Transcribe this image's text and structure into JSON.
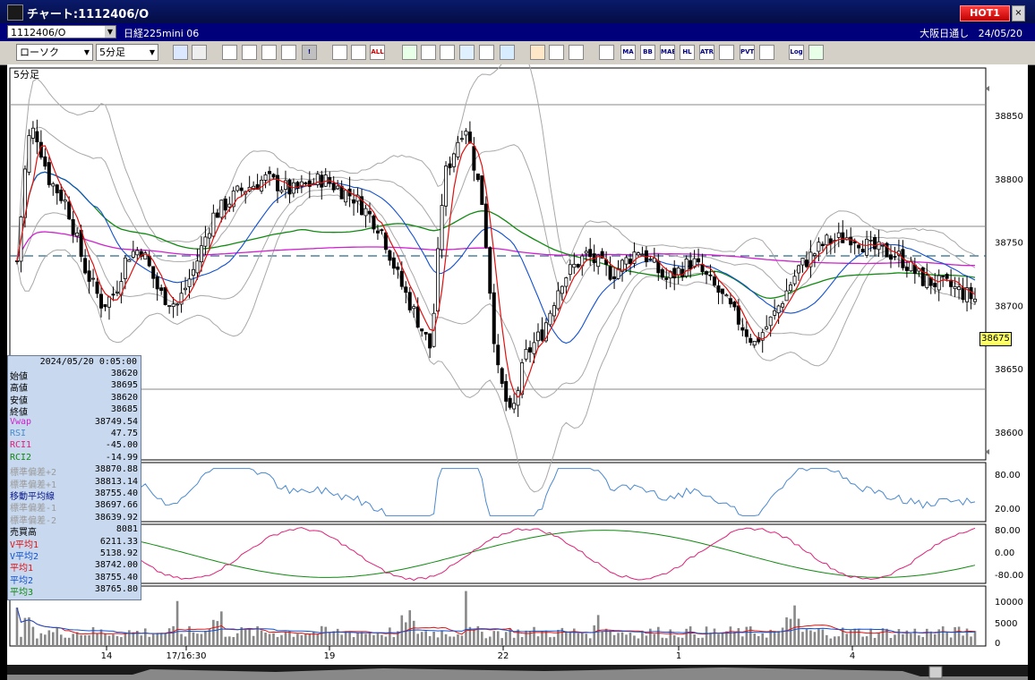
{
  "window": {
    "title": "チャート:1112406/O",
    "hot_label": "HOT1",
    "min": "_",
    "max": "□",
    "close": "×"
  },
  "infobar": {
    "code": "1112406/O",
    "name": "日経225mini 06",
    "market": "大阪日通し",
    "date": "24/05/20"
  },
  "toolbar": {
    "chart_type": "ローソク",
    "period": "5分足",
    "buttons": [
      {
        "icon": "zoom-icon",
        "text": ""
      },
      {
        "icon": "layout-icon",
        "text": ""
      },
      {
        "icon": "cut-icon",
        "text": ""
      },
      {
        "icon": "find-icon",
        "text": ""
      },
      {
        "icon": "bar-icon",
        "text": ""
      },
      {
        "icon": "sign-icon",
        "text": ""
      },
      {
        "icon": "warn-icon",
        "text": "!"
      },
      {
        "icon": "cross-icon",
        "text": ""
      },
      {
        "icon": "cross2-icon",
        "text": ""
      },
      {
        "icon": "all-icon",
        "text": "ALL"
      },
      {
        "icon": "pen-icon",
        "text": ""
      },
      {
        "icon": "line-icon",
        "text": ""
      },
      {
        "icon": "pointer-icon",
        "text": ""
      },
      {
        "icon": "arrow-icon",
        "text": ""
      },
      {
        "icon": "list-icon",
        "text": ""
      },
      {
        "icon": "trash-icon",
        "text": ""
      },
      {
        "icon": "setting-icon",
        "text": ""
      },
      {
        "icon": "wrench-icon",
        "text": ""
      },
      {
        "icon": "palette-icon",
        "text": ""
      },
      {
        "icon": "indicator-icon",
        "text": ""
      },
      {
        "icon": "ma-icon",
        "text": "MA"
      },
      {
        "icon": "bb-icon",
        "text": "BB"
      },
      {
        "icon": "mae-icon",
        "text": "MAE"
      },
      {
        "icon": "hl-icon",
        "text": "HL"
      },
      {
        "icon": "atr-icon",
        "text": "ATR"
      },
      {
        "icon": "grid-icon",
        "text": ""
      },
      {
        "icon": "pvt-icon",
        "text": "PVT"
      },
      {
        "icon": "box-icon",
        "text": ""
      },
      {
        "icon": "log-icon",
        "text": "Log"
      },
      {
        "icon": "export-icon",
        "text": ""
      }
    ]
  },
  "chart": {
    "period_label": "5分足",
    "price_axis": [
      "38850",
      "38800",
      "38750",
      "38700",
      "38650",
      "38600"
    ],
    "rsi_axis": [
      "80.00",
      "20.00"
    ],
    "rci_axis": [
      "80.00",
      "0.00",
      "-80.00"
    ],
    "vol_axis": [
      "10000",
      "5000",
      "0"
    ],
    "x_labels": [
      "14",
      "17/16:30",
      "19",
      "22",
      "1",
      "4"
    ],
    "current_price": "38675",
    "colors": {
      "up": "#ffffff",
      "down": "#000000",
      "rsi": "#4a8ad0",
      "rci1": "#e0207a",
      "rci2": "#108a10",
      "ma_red": "#e01010",
      "ma_blue": "#1050d0",
      "ma_green": "#108a10",
      "vwap": "#d020d0",
      "bands": "#a8a8a8",
      "volume": "#888888"
    }
  },
  "panel": {
    "timestamp": "2024/05/20  0:05:00",
    "rows": [
      {
        "label": "始値",
        "value": "38620",
        "color": "#000000"
      },
      {
        "label": "高値",
        "value": "38695",
        "color": "#000000"
      },
      {
        "label": "安値",
        "value": "38620",
        "color": "#000000"
      },
      {
        "label": "終値",
        "value": "38685",
        "color": "#000000"
      },
      {
        "label": "Vwap",
        "value": "38749.54",
        "color": "#d020d0"
      },
      {
        "label": "RSI",
        "value": "47.75",
        "color": "#4a8ad0"
      },
      {
        "label": "RCI1",
        "value": "-45.00",
        "color": "#e0207a"
      },
      {
        "label": "RCI2",
        "value": "-14.99",
        "color": "#108a10"
      },
      {
        "label": "標準偏差+2",
        "value": "38870.88",
        "color": "#9a9a9a"
      },
      {
        "label": "標準偏差+1",
        "value": "38813.14",
        "color": "#9a9a9a"
      },
      {
        "label": "移動平均線",
        "value": "38755.40",
        "color": "#0a1a8a"
      },
      {
        "label": "標準偏差-1",
        "value": "38697.66",
        "color": "#9a9a9a"
      },
      {
        "label": "標準偏差-2",
        "value": "38639.92",
        "color": "#9a9a9a"
      },
      {
        "label": "売買高",
        "value": "8081",
        "color": "#000000"
      },
      {
        "label": "V平均1",
        "value": "6211.33",
        "color": "#e01010"
      },
      {
        "label": "V平均2",
        "value": "5138.92",
        "color": "#1050d0"
      },
      {
        "label": "平均1",
        "value": "38742.00",
        "color": "#e01010"
      },
      {
        "label": "平均2",
        "value": "38755.40",
        "color": "#1050d0"
      },
      {
        "label": "平均3",
        "value": "38765.80",
        "color": "#108a10"
      }
    ]
  }
}
